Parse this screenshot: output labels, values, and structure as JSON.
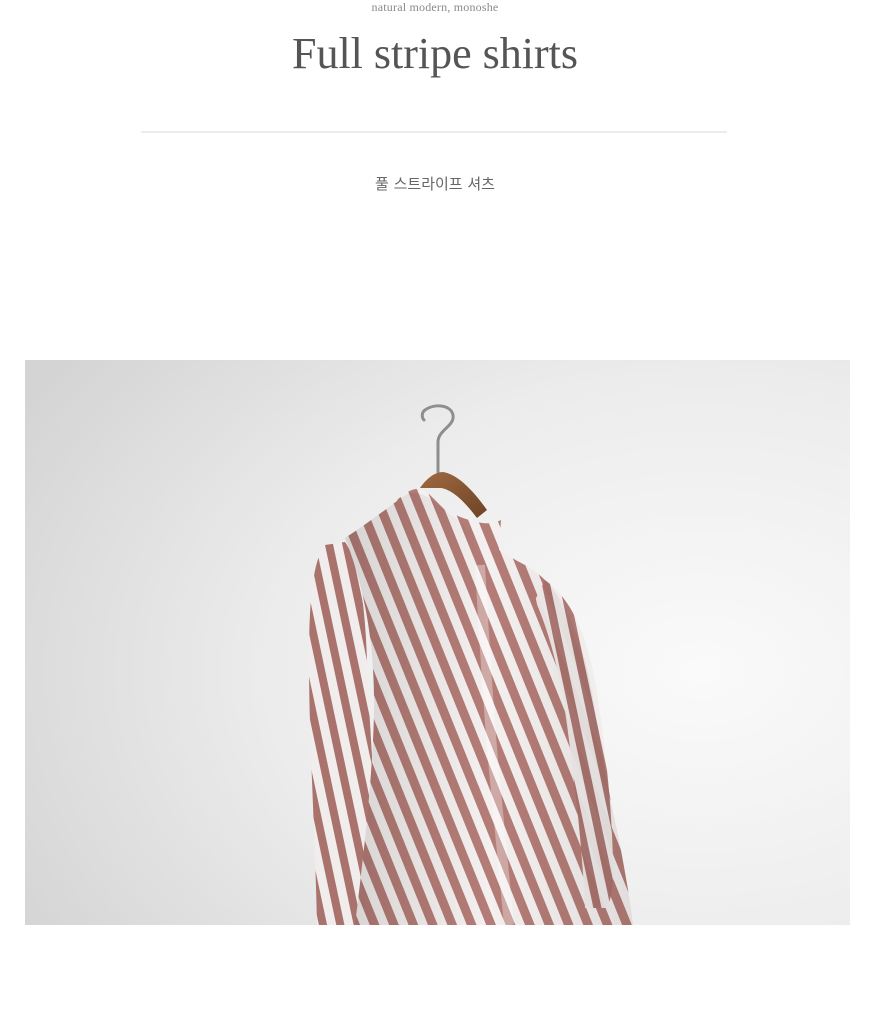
{
  "header": {
    "tagline": "natural modern, monoshe",
    "title": "Full stripe shirts",
    "subtitle": "풀 스트라이프 셔츠"
  },
  "colors": {
    "title_text": "#555555",
    "tagline_text": "#8a8a8a",
    "divider": "#ececec",
    "stripe": "#b57d78",
    "shirt_base": "#f3efee",
    "wall": "#e6e6e6",
    "hanger_wood": "#8a5a36"
  },
  "photo": {
    "subject": "striped-shirt-on-hanger"
  }
}
